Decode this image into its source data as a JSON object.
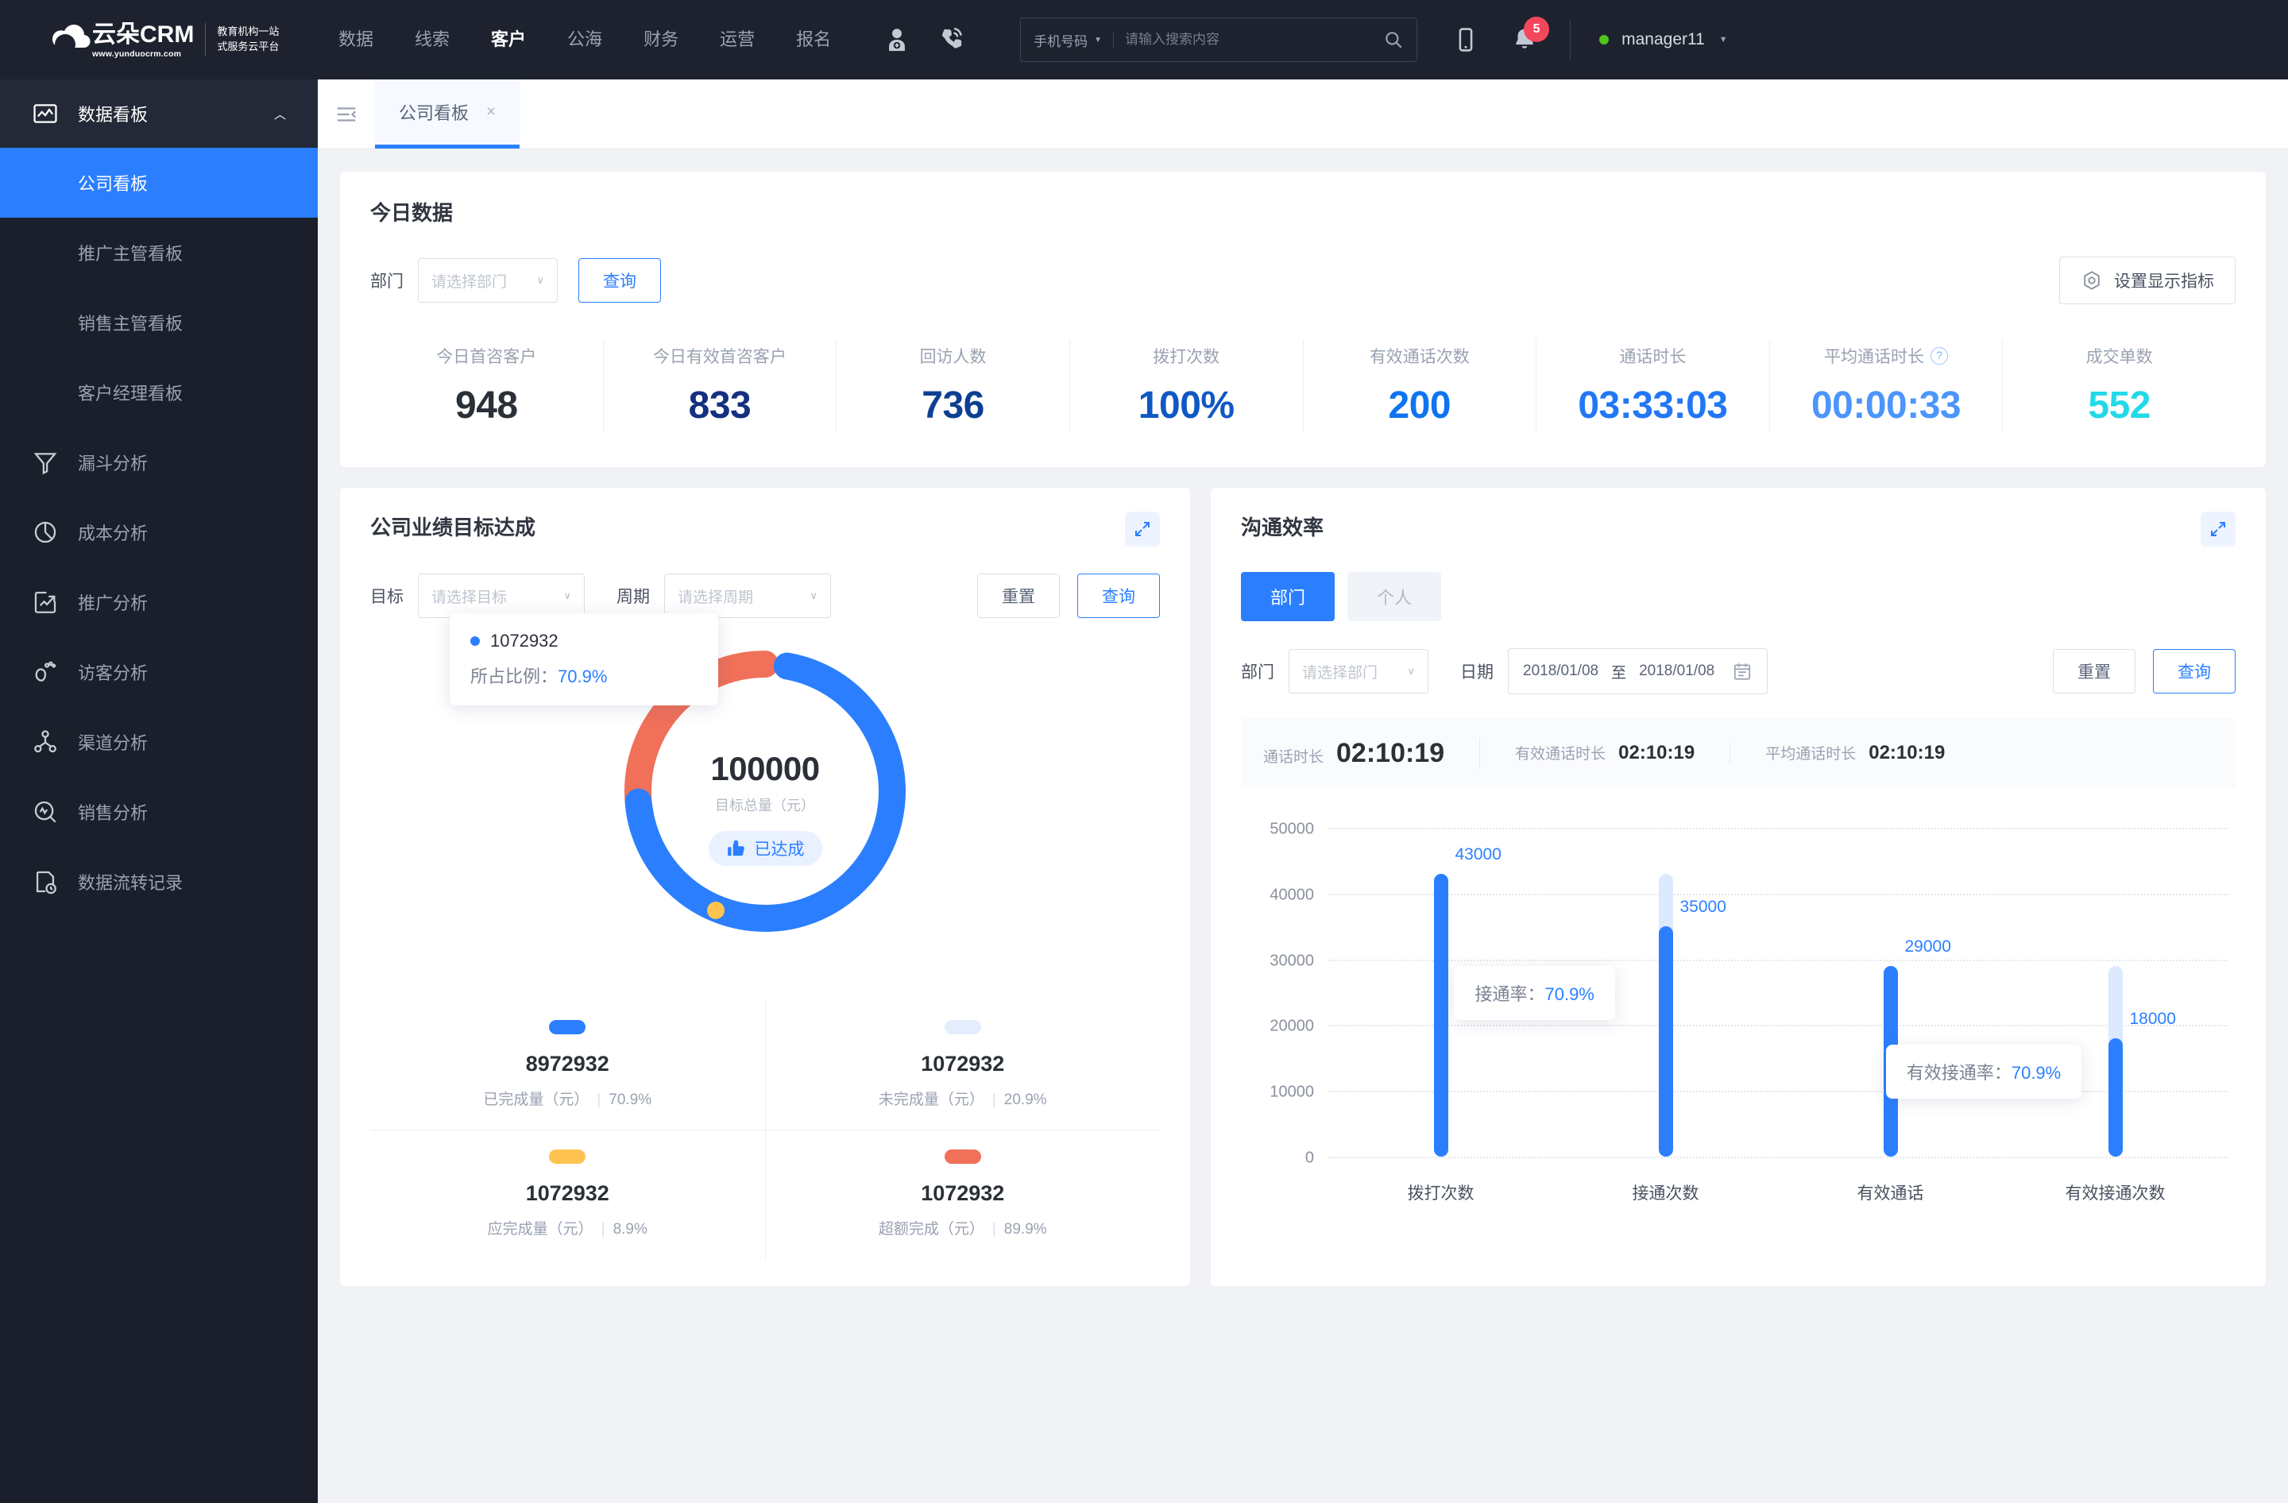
{
  "header": {
    "logo": {
      "name": "云朵CRM",
      "url": "www.yunduocrm.com",
      "sub_line1": "教育机构一站",
      "sub_line2": "式服务云平台"
    },
    "nav": [
      {
        "label": "数据",
        "active": false
      },
      {
        "label": "线索",
        "active": false
      },
      {
        "label": "客户",
        "active": true
      },
      {
        "label": "公海",
        "active": false
      },
      {
        "label": "财务",
        "active": false
      },
      {
        "label": "运营",
        "active": false
      },
      {
        "label": "报名",
        "active": false
      }
    ],
    "icons": {
      "add_user": "add-user-icon",
      "call": "phone-call-icon",
      "mobile": "mobile-icon",
      "bell": "bell-icon"
    },
    "search": {
      "type": "手机号码",
      "placeholder": "请输入搜索内容",
      "value": ""
    },
    "notification_count": "5",
    "user": "manager11"
  },
  "sidebar": {
    "group": {
      "label": "数据看板",
      "icon": "dashboard-icon",
      "expanded": true
    },
    "sub_items": [
      {
        "label": "公司看板",
        "active": true
      },
      {
        "label": "推广主管看板",
        "active": false
      },
      {
        "label": "销售主管看板",
        "active": false
      },
      {
        "label": "客户经理看板",
        "active": false
      }
    ],
    "items": [
      {
        "label": "漏斗分析",
        "icon": "funnel-icon"
      },
      {
        "label": "成本分析",
        "icon": "pie-chart-icon"
      },
      {
        "label": "推广分析",
        "icon": "trend-chart-icon"
      },
      {
        "label": "访客分析",
        "icon": "footprint-icon"
      },
      {
        "label": "渠道分析",
        "icon": "share-nodes-icon"
      },
      {
        "label": "销售分析",
        "icon": "analytics-search-icon"
      },
      {
        "label": "数据流转记录",
        "icon": "data-flow-icon"
      }
    ]
  },
  "tabbar": {
    "collapse_icon": "collapse-menu-icon",
    "tabs": [
      {
        "label": "公司看板",
        "close": "×",
        "active": true
      }
    ]
  },
  "today": {
    "title": "今日数据",
    "dept_label": "部门",
    "dept_placeholder": "请选择部门",
    "query_label": "查询",
    "settings_label": "设置显示指标",
    "kpis": [
      {
        "label": "今日首咨客户",
        "value": "948",
        "color": "#2b3038",
        "help": false
      },
      {
        "label": "今日有效首咨客户",
        "value": "833",
        "color": "#14307f",
        "help": false
      },
      {
        "label": "回访人数",
        "value": "736",
        "color": "#0d3f92",
        "help": false
      },
      {
        "label": "拨打次数",
        "value": "100%",
        "color": "#0f58c4",
        "help": false
      },
      {
        "label": "有效通话次数",
        "value": "200",
        "color": "#0e74f0",
        "help": false
      },
      {
        "label": "通话时长",
        "value": "03:33:03",
        "color": "#2277f5",
        "help": false
      },
      {
        "label": "平均通话时长",
        "value": "00:00:33",
        "color": "#4c95fb",
        "help": true
      },
      {
        "label": "成交单数",
        "value": "552",
        "color": "#23d9e8",
        "help": false
      }
    ]
  },
  "goal_panel": {
    "title": "公司业绩目标达成",
    "expand_icon": "expand-icon",
    "goal_label": "目标",
    "goal_placeholder": "请选择目标",
    "period_label": "周期",
    "period_placeholder": "请选择周期",
    "reset_label": "重置",
    "query_label": "查询",
    "tooltip": {
      "value": "1072932",
      "ratio_label": "所占比例：",
      "ratio": "70.9%"
    },
    "center": {
      "total": "100000",
      "caption": "目标总量（元）",
      "badge": "已达成",
      "badge_icon": "thumbs-up-icon"
    },
    "legend": [
      {
        "color": "#2b7fff",
        "value": "8972932",
        "caption": "已完成量（元）",
        "pct": "70.9%"
      },
      {
        "color": "#e4edfd",
        "value": "1072932",
        "caption": "未完成量（元）",
        "pct": "20.9%"
      },
      {
        "color": "#ffc351",
        "value": "1072932",
        "caption": "应完成量（元）",
        "pct": "8.9%"
      },
      {
        "color": "#f0705a",
        "value": "1072932",
        "caption": "超额完成（元）",
        "pct": "89.9%"
      }
    ],
    "donut_data": {
      "type": "pie",
      "segments": [
        {
          "name": "已完成量",
          "pct": 70.9,
          "color": "#2b7fff"
        },
        {
          "name": "超额完成",
          "pct": 29.1,
          "color": "#f0705a"
        }
      ]
    }
  },
  "comm_panel": {
    "title": "沟通效率",
    "expand_icon": "expand-icon",
    "segments": [
      {
        "label": "部门",
        "active": true
      },
      {
        "label": "个人",
        "active": false
      }
    ],
    "dept_label": "部门",
    "dept_placeholder": "请选择部门",
    "date_label": "日期",
    "date_from": "2018/01/08",
    "date_to_sep": "至",
    "date_to": "2018/01/08",
    "calendar_icon": "calendar-icon",
    "reset_label": "重置",
    "query_label": "查询",
    "durations": [
      {
        "label": "通话时长",
        "value": "02:10:19",
        "big": true
      },
      {
        "label": "有效通话时长",
        "value": "02:10:19",
        "big": false
      },
      {
        "label": "平均通话时长",
        "value": "02:10:19",
        "big": false
      }
    ],
    "tooltips": [
      {
        "label": "接通率：",
        "value": "70.9%"
      },
      {
        "label": "有效接通率：",
        "value": "70.9%"
      }
    ]
  },
  "chart_data": {
    "type": "bar",
    "title": "沟通效率",
    "categories": [
      "拨打次数",
      "接通次数",
      "有效通话",
      "有效接通次数"
    ],
    "values": [
      43000,
      35000,
      29000,
      18000
    ],
    "track_values": [
      43000,
      43000,
      29000,
      29000
    ],
    "labels": [
      "43000",
      "35000",
      "29000",
      "18000"
    ],
    "yticks": [
      "50000",
      "40000",
      "30000",
      "20000",
      "10000",
      "0"
    ],
    "ylim": [
      0,
      50000
    ],
    "xlabel": "",
    "ylabel": "",
    "grid": true,
    "legend": "none",
    "bar_color": "#2b7fff",
    "track_color": "#dce9ff"
  }
}
